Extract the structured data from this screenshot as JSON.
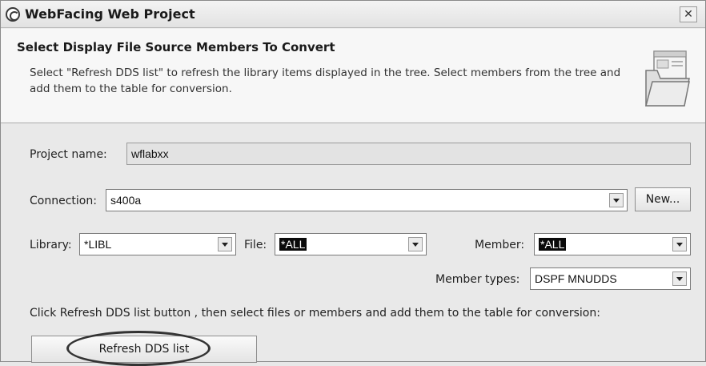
{
  "window": {
    "title": "WebFacing Web Project"
  },
  "header": {
    "title": "Select Display File Source Members To Convert",
    "description": "Select \"Refresh DDS list\" to refresh the library items displayed in the tree. Select members from the tree and add them to the table for conversion."
  },
  "form": {
    "project_label": "Project name:",
    "project_value": "wflabxx",
    "connection_label": "Connection:",
    "connection_value": "s400a",
    "new_button": "New...",
    "library_label": "Library:",
    "library_value": "*LIBL",
    "file_label": "File:",
    "file_value": "*ALL",
    "member_label": "Member:",
    "member_value": "*ALL",
    "member_types_label": "Member types:",
    "member_types_value": "DSPF MNUDDS",
    "instruction": "Click Refresh DDS list button , then select files or members and add them to the table for conversion:",
    "refresh_button": "Refresh DDS list"
  }
}
